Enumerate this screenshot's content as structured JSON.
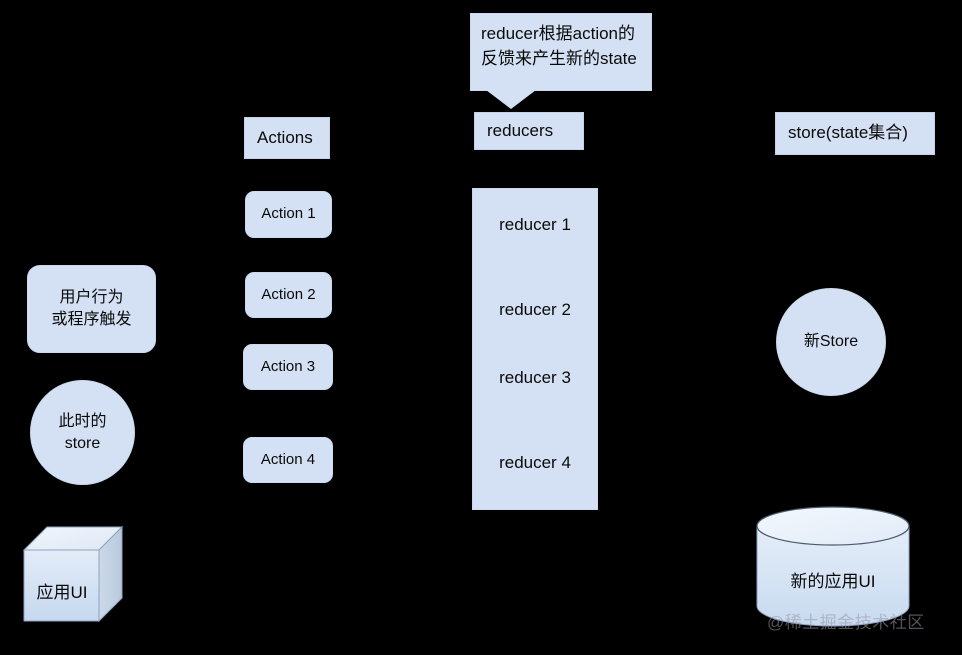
{
  "diagram": {
    "background_color": "#000000",
    "node_fill": "#d4e1f4",
    "node_stroke": "#cbd9ee",
    "text_color": "#0a0a0a"
  },
  "callout": {
    "text": "reducer根据action的反馈来产生新的state"
  },
  "columns": {
    "actions_header": "Actions",
    "reducers_header": "reducers",
    "store_header": "store(state集合)"
  },
  "actions": [
    {
      "label": "Action 1"
    },
    {
      "label": "Action 2"
    },
    {
      "label": "Action 3"
    },
    {
      "label": "Action 4"
    }
  ],
  "reducers": [
    {
      "label": "reducer 1"
    },
    {
      "label": "reducer 2"
    },
    {
      "label": "reducer 3"
    },
    {
      "label": "reducer 4"
    }
  ],
  "left_column": {
    "trigger": "用户行为\n或程序触发",
    "current_store": "此时的\nstore",
    "app_ui": "应用UI"
  },
  "right_column": {
    "new_store": "新Store",
    "new_app_ui": "新的应用UI"
  },
  "watermark": {
    "text": "@稀土掘金技术社区"
  }
}
